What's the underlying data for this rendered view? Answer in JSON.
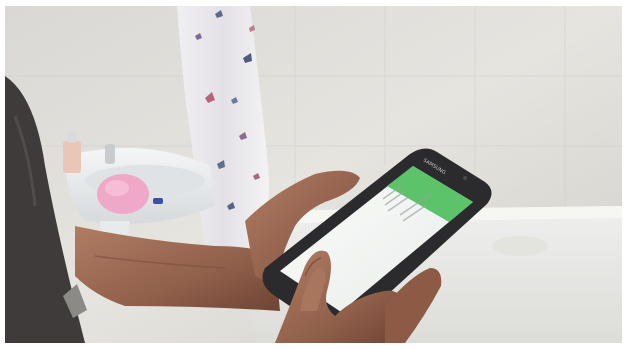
{
  "scene": {
    "kind": "photograph",
    "subject": "hand-holding-smartphone-in-bathroom",
    "colors": {
      "wall": "#dedcd7",
      "tile_shadow": "#c9c7c1",
      "curtain": "#e9e7ec",
      "sink": "#eceff0",
      "sponge": "#f0a8c8",
      "skin": "#9b6b55",
      "skin_shadow": "#6f4636",
      "sleeve": "#3e3b3a",
      "phone_body": "#2b2b2d",
      "app_bar": "#5cc36a",
      "screen": "#f6f7f6"
    }
  },
  "phone": {
    "brand_mark": "SAMSUNG",
    "app_bar_color": "#5cc36a"
  }
}
